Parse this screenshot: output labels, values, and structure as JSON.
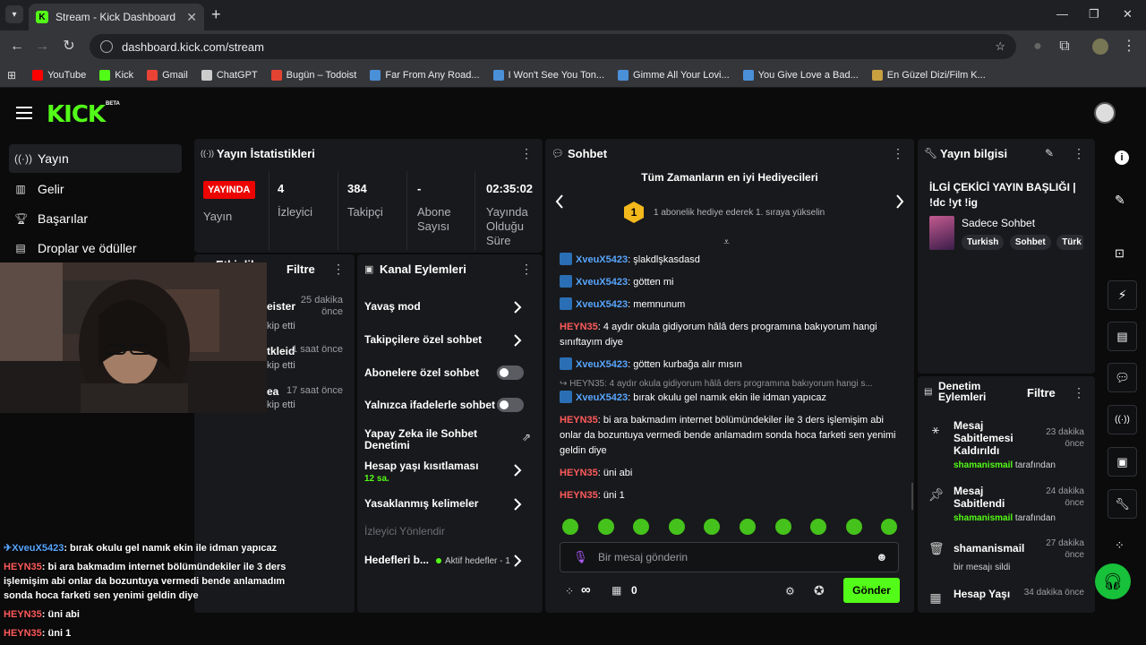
{
  "browser": {
    "tab_title": "Stream - Kick Dashboard",
    "tab_favicon_letter": "K",
    "url": "dashboard.kick.com/stream",
    "bookmarks": [
      {
        "label": "YouTube",
        "color": "#ff0000"
      },
      {
        "label": "Kick",
        "color": "#53fc18"
      },
      {
        "label": "Gmail",
        "color": "#ea4335"
      },
      {
        "label": "ChatGPT",
        "color": "#cccccc"
      },
      {
        "label": "Bugün – Todoist",
        "color": "#e44332"
      },
      {
        "label": "Far From Any Road...",
        "color": "#4a90d9"
      },
      {
        "label": "I Won't See You Ton...",
        "color": "#4a90d9"
      },
      {
        "label": "Gimme All Your Lovi...",
        "color": "#4a90d9"
      },
      {
        "label": "You Give Love a Bad...",
        "color": "#4a90d9"
      },
      {
        "label": "En Güzel Dizi/Film K...",
        "color": "#c8a040"
      }
    ]
  },
  "header": {
    "logo": "KICK",
    "beta": "BETA"
  },
  "leftnav": {
    "items": [
      {
        "label": "Yayın",
        "icon": "broadcast-icon"
      },
      {
        "label": "Gelir",
        "icon": "chart-icon"
      },
      {
        "label": "Başarılar",
        "icon": "trophy-icon"
      },
      {
        "label": "Droplar ve ödüller",
        "icon": "gift-icon"
      }
    ]
  },
  "stats": {
    "title": "Yayın İstatistikleri",
    "live_badge": "YAYINDA",
    "live_label": "Yayın",
    "viewers_value": "4",
    "viewers_label": "İzleyici",
    "followers_value": "384",
    "followers_label": "Takipçi",
    "subs_value": "-",
    "subs_label": "Abone Sayısı",
    "duration_value": "02:35:02",
    "duration_label": "Yayında Olduğu Süre"
  },
  "activity": {
    "title": "Etkinlik",
    "filter": "Filtre",
    "items": [
      {
        "name": "eister",
        "sub": "kip etti",
        "time": "25 dakika önce"
      },
      {
        "name": "tkleid",
        "sub": "kip etti",
        "time": "1 saat önce"
      },
      {
        "name": "ea",
        "sub": "kip etti",
        "time": "17 saat önce"
      }
    ]
  },
  "channel_actions": {
    "title": "Kanal Eylemleri",
    "slow_mode": "Yavaş mod",
    "followers_only": "Takipçilere özel sohbet",
    "subs_only": "Abonelere özel sohbet",
    "emotes_only": "Yalnızca ifadelerle sohbet",
    "ai_moderation": "Yapay Zeka ile Sohbet Denetimi",
    "account_age": "Hesap yaşı kısıtlaması",
    "account_age_value": "12 sa.",
    "banned_words": "Yasaklanmış kelimeler",
    "viewer_redirect": "İzleyici Yönlendir",
    "goals": "Hedefleri b...",
    "goals_status": "Aktif hedefler - 1"
  },
  "chat": {
    "title": "Sohbet",
    "top_gifters": "Tüm Zamanların en iyi Hediyecileri",
    "gift_rank": "1",
    "gift_hint": "1 abonelik hediye ederek 1. sıraya yükselin",
    "messages": [
      {
        "user": "XveuX5423",
        "text": ": şlakdlşkasdasd",
        "color": "blue",
        "badge": true
      },
      {
        "user": "XveuX5423",
        "text": ": götten mi",
        "color": "blue",
        "badge": true
      },
      {
        "user": "XveuX5423",
        "text": ": memnunum",
        "color": "blue",
        "badge": true
      },
      {
        "user": "HEYN35",
        "text": ": 4 aydır okula gidiyorum hâlâ ders programına bakıyorum hangi sınıftayım diye",
        "color": "red",
        "badge": false
      },
      {
        "user": "XveuX5423",
        "text": ": götten kurbağa alır mısın",
        "color": "blue",
        "badge": true
      },
      {
        "user": "XveuX5423",
        "text": ": bırak okulu gel namık ekin ile idman yapıcaz",
        "color": "blue",
        "badge": true
      },
      {
        "user": "HEYN35",
        "text": ": bi ara bakmadım internet bölümündekiler ile 3 ders işlemişim abi onlar da bozuntuya vermedi bende anlamadım sonda hoca farketi sen yenimi geldin diye",
        "color": "red",
        "badge": false
      },
      {
        "user": "HEYN35",
        "text": ": üni abi",
        "color": "red",
        "badge": false
      },
      {
        "user": "HEYN35",
        "text": ": üni 1",
        "color": "red",
        "badge": false
      }
    ],
    "reply_preview": "HEYN35: 4 aydır okula gidiyorum hâlâ ders programına bakıyorum hangi s...",
    "input_placeholder": "Bir mesaj gönderin",
    "points": "∞",
    "gifts": "0",
    "send": "Gönder"
  },
  "stream_info": {
    "title": "Yayın bilgisi",
    "stream_title": "İLGİ ÇEKİCİ YAYIN BAŞLIĞI | !dc !yt !ig",
    "category": "Sadece Sohbet",
    "tags": [
      "Turkish",
      "Sohbet",
      "Türk"
    ]
  },
  "mod_actions": {
    "title": "Denetim Eylemleri",
    "filter": "Filtre",
    "items": [
      {
        "title": "Mesaj Sabitlemesi Kaldırıldı",
        "by_user": "shamanismail",
        "by_suffix": " tarafından",
        "time": "23 dakika önce",
        "icon": "unpin-icon"
      },
      {
        "title": "Mesaj Sabitlendi",
        "by_user": "shamanismail",
        "by_suffix": " tarafından",
        "time": "24 dakika önce",
        "icon": "pin-icon"
      },
      {
        "title": "shamanismail",
        "by_user": "",
        "by_suffix": "bir mesajı sildi",
        "time": "27 dakika önce",
        "icon": "trash-icon"
      },
      {
        "title": "Hesap Yaşı",
        "by_user": "",
        "by_suffix": "",
        "time": "34 dakika önce",
        "icon": "calendar-icon"
      }
    ]
  },
  "overlay_chat": [
    {
      "user": "XveuX5423",
      "text": ": bırak okulu gel namık ekin ile idman yapıcaz",
      "color": "blue"
    },
    {
      "user": "HEYN35",
      "text": ": bi ara bakmadım internet bölümündekiler ile 3 ders işlemişim abi onlar da bozuntuya vermedi bende anlamadım sonda hoca farketi sen yenimi geldin diye",
      "color": "red"
    },
    {
      "user": "HEYN35",
      "text": ": üni abi",
      "color": "red"
    },
    {
      "user": "HEYN35",
      "text": ": üni 1",
      "color": "red"
    }
  ],
  "colors": {
    "brand": "#53fc18",
    "live": "#eb0400",
    "panel": "#18191c"
  }
}
